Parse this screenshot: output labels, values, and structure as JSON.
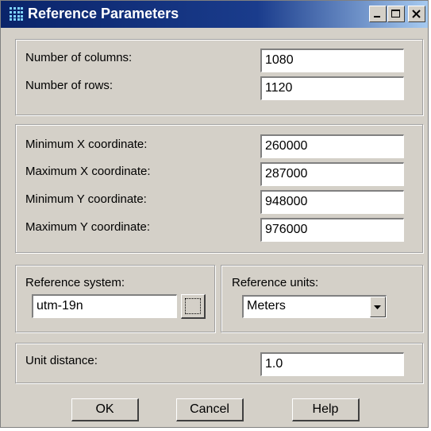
{
  "window": {
    "title": "Reference Parameters",
    "icon": "grid-app-icon",
    "controls": [
      "minimize-icon",
      "maximize-icon",
      "close-icon"
    ]
  },
  "dimensions": {
    "columns_label": "Number of columns:",
    "columns_value": "1080",
    "rows_label": "Number of rows:",
    "rows_value": "1120"
  },
  "coordinates": {
    "min_x_label": "Minimum X coordinate:",
    "min_x_value": "260000",
    "max_x_label": "Maximum X coordinate:",
    "max_x_value": "287000",
    "min_y_label": "Minimum Y coordinate:",
    "min_y_value": "948000",
    "max_y_label": "Maximum Y coordinate:",
    "max_y_value": "976000"
  },
  "reference_system": {
    "label": "Reference system:",
    "value": "utm-19n"
  },
  "reference_units": {
    "label": "Reference units:",
    "selected": "Meters"
  },
  "unit_distance": {
    "label": "Unit distance:",
    "value": "1.0"
  },
  "buttons": {
    "ok": "OK",
    "cancel": "Cancel",
    "help": "Help"
  },
  "colors": {
    "titlebar_start": "#0a246a",
    "titlebar_end": "#a6caf0",
    "face": "#d4d0c8"
  }
}
